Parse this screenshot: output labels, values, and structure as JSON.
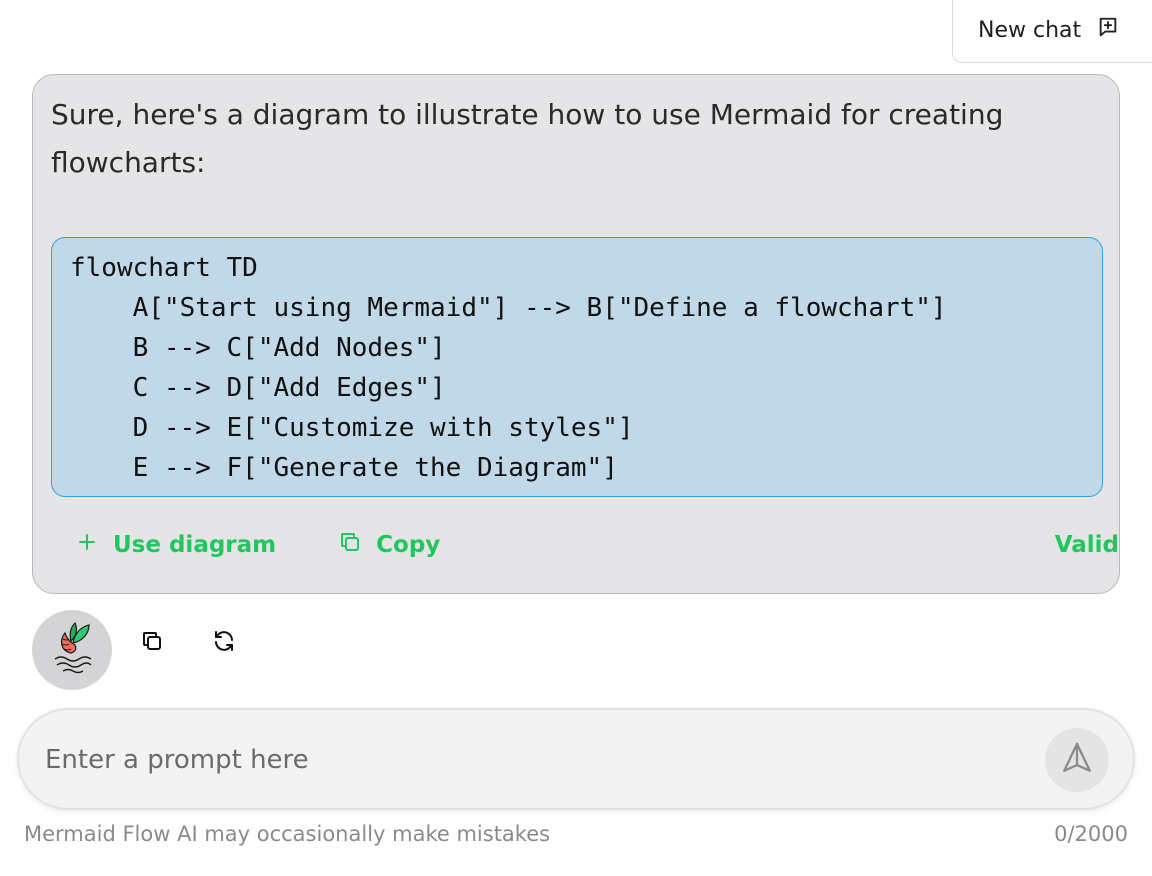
{
  "header": {
    "new_chat_label": "New chat",
    "new_chat_icon": "message-plus-icon"
  },
  "message": {
    "text": "Sure, here's a diagram to illustrate how to use Mermaid for creating flowcharts:",
    "code_lines": [
      "flowchart TD",
      "    A[\"Start using Mermaid\"] --> B[\"Define a flowchart\"]",
      "    B --> C[\"Add Nodes\"]",
      "    C --> D[\"Add Edges\"]",
      "    D --> E[\"Customize with styles\"]",
      "    E --> F[\"Generate the Diagram\"]"
    ],
    "use_diagram_label": "Use diagram",
    "copy_label": "Copy",
    "status_label": "Valid"
  },
  "message_tools": {
    "copy_icon": "copy-icon",
    "regenerate_icon": "refresh-icon"
  },
  "prompt": {
    "placeholder": "Enter a prompt here",
    "value": "",
    "send_icon": "send-icon"
  },
  "footer": {
    "disclaimer": "Mermaid Flow AI may occasionally make mistakes",
    "char_count": "0/2000"
  },
  "colors": {
    "accent_green": "#22c55e",
    "code_bg": "#c0d8e8",
    "code_border": "#2ea3e3",
    "bubble_bg": "#e5e5e7"
  }
}
